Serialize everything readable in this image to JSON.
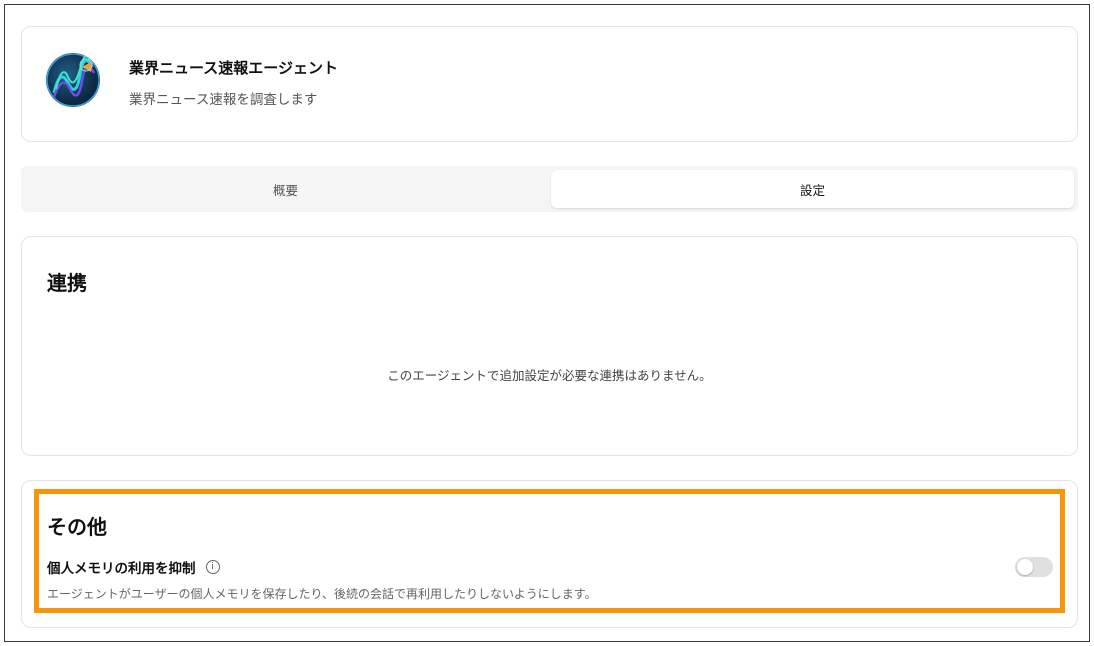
{
  "agent": {
    "name": "業界ニュース速報エージェント",
    "description": "業界ニュース速報を調査します"
  },
  "tabs": [
    {
      "label": "概要",
      "selected": false
    },
    {
      "label": "設定",
      "selected": true
    }
  ],
  "integration": {
    "title": "連携",
    "empty_message": "このエージェントで追加設定が必要な連携はありません。"
  },
  "other": {
    "title": "その他",
    "setting_label": "個人メモリの利用を抑制",
    "info_icon": "i",
    "setting_description": "エージェントがユーザーの個人メモリを保存したり、後続の会話で再利用したりしないようにします。",
    "toggle_on": false
  },
  "colors": {
    "highlight": "#f7960d",
    "toggle_off": "#e0e0e0"
  }
}
